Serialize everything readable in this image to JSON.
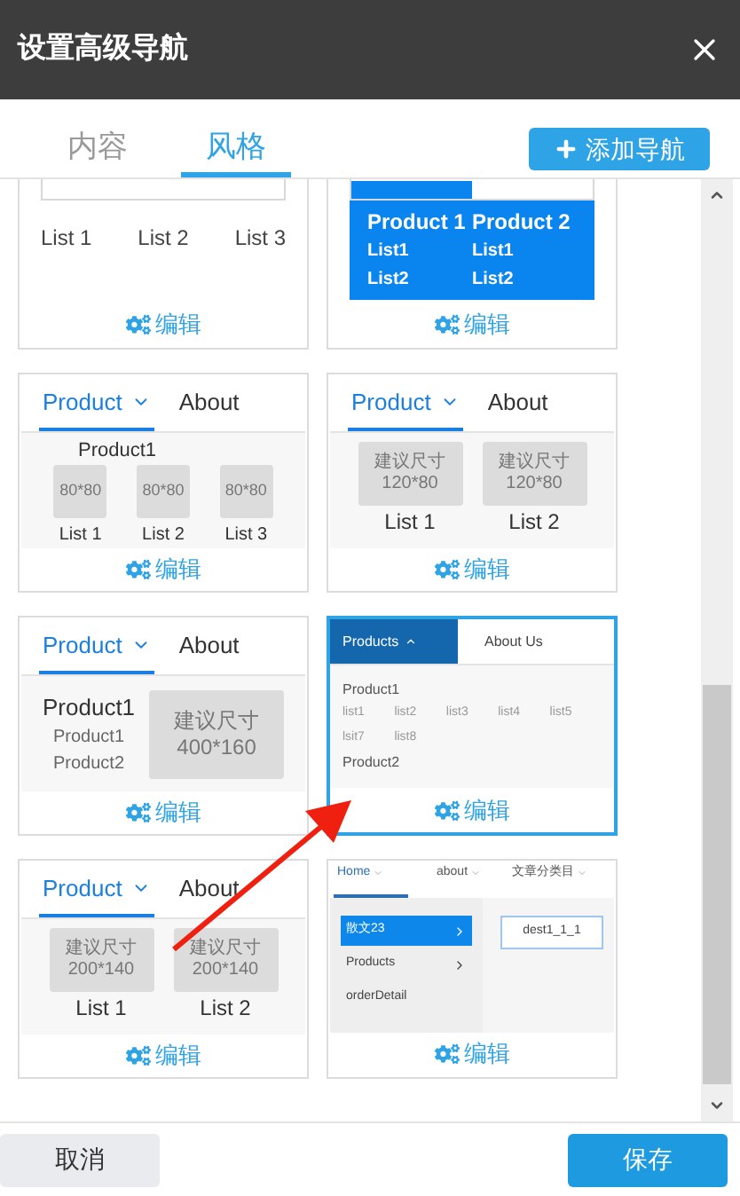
{
  "dialog": {
    "title": "设置高级导航"
  },
  "tabs": [
    {
      "label": "内容",
      "selected": false
    },
    {
      "label": "风格",
      "selected": true
    }
  ],
  "add_button": "添加导航",
  "styles": [
    {
      "kind": "plain-lists",
      "selected": false,
      "edit": "编辑",
      "items": [
        "List 1",
        "List 2",
        "List 3"
      ]
    },
    {
      "kind": "blue-columns",
      "selected": false,
      "edit": "编辑",
      "columns": [
        {
          "title": "Product 1",
          "items": [
            "List1",
            "List2"
          ]
        },
        {
          "title": "Product 2",
          "items": [
            "List1",
            "List2"
          ]
        }
      ]
    },
    {
      "kind": "tab-thumbs",
      "selected": false,
      "edit": "编辑",
      "tabs": [
        {
          "label": "Product",
          "selected": true,
          "dropdown": true
        },
        {
          "label": "About",
          "selected": false,
          "dropdown": false
        }
      ],
      "heading": "Product1",
      "thumbs": [
        {
          "lines": [
            "80*80"
          ],
          "label": "List 1"
        },
        {
          "lines": [
            "80*80"
          ],
          "label": "List 2"
        },
        {
          "lines": [
            "80*80"
          ],
          "label": "List 3"
        }
      ]
    },
    {
      "kind": "tab-thumbs",
      "selected": false,
      "edit": "编辑",
      "tabs": [
        {
          "label": "Product",
          "selected": true,
          "dropdown": true
        },
        {
          "label": "About",
          "selected": false,
          "dropdown": false
        }
      ],
      "thumbs": [
        {
          "lines": [
            "建议尺寸",
            "120*80"
          ],
          "label": "List 1"
        },
        {
          "lines": [
            "建议尺寸",
            "120*80"
          ],
          "label": "List 2"
        }
      ]
    },
    {
      "kind": "tab-banner",
      "selected": false,
      "edit": "编辑",
      "tabs": [
        {
          "label": "Product",
          "selected": true,
          "dropdown": true
        },
        {
          "label": "About",
          "selected": false,
          "dropdown": false
        }
      ],
      "heading": "Product1",
      "links": [
        "Product1",
        "Product2"
      ],
      "banner": [
        "建议尺寸",
        "400*160"
      ]
    },
    {
      "kind": "mega-menu",
      "selected": true,
      "edit": "编辑",
      "tabs": [
        {
          "label": "Products",
          "selected": true,
          "dropdown": true
        },
        {
          "label": "About Us",
          "selected": false,
          "dropdown": false
        }
      ],
      "groups": [
        {
          "title": "Product1",
          "items": [
            "list1",
            "list2",
            "list3",
            "list4",
            "list5",
            "lsit7",
            "list8"
          ]
        },
        {
          "title": "Product2"
        }
      ]
    },
    {
      "kind": "tab-thumbs",
      "selected": false,
      "edit": "编辑",
      "tabs": [
        {
          "label": "Product",
          "selected": true,
          "dropdown": true
        },
        {
          "label": "About",
          "selected": false,
          "dropdown": false
        }
      ],
      "thumbs": [
        {
          "lines": [
            "建议尺寸",
            "200*140"
          ],
          "label": "List 1"
        },
        {
          "lines": [
            "建议尺寸",
            "200*140"
          ],
          "label": "List 2"
        }
      ]
    },
    {
      "kind": "side-menu",
      "selected": false,
      "edit": "编辑",
      "tabs": [
        {
          "label": "Home",
          "selected": true,
          "dropdown": true
        },
        {
          "label": "about",
          "selected": false,
          "dropdown": true
        },
        {
          "label": "文章分类目",
          "selected": false,
          "dropdown": true
        }
      ],
      "menu": [
        {
          "label": "散文23",
          "selected": true,
          "has_children": true
        },
        {
          "label": "Products",
          "selected": false,
          "has_children": true
        },
        {
          "label": "orderDetail",
          "selected": false,
          "has_children": false
        }
      ],
      "detail": "dest1_1_1"
    }
  ],
  "footer": {
    "cancel": "取消",
    "save": "保存"
  }
}
